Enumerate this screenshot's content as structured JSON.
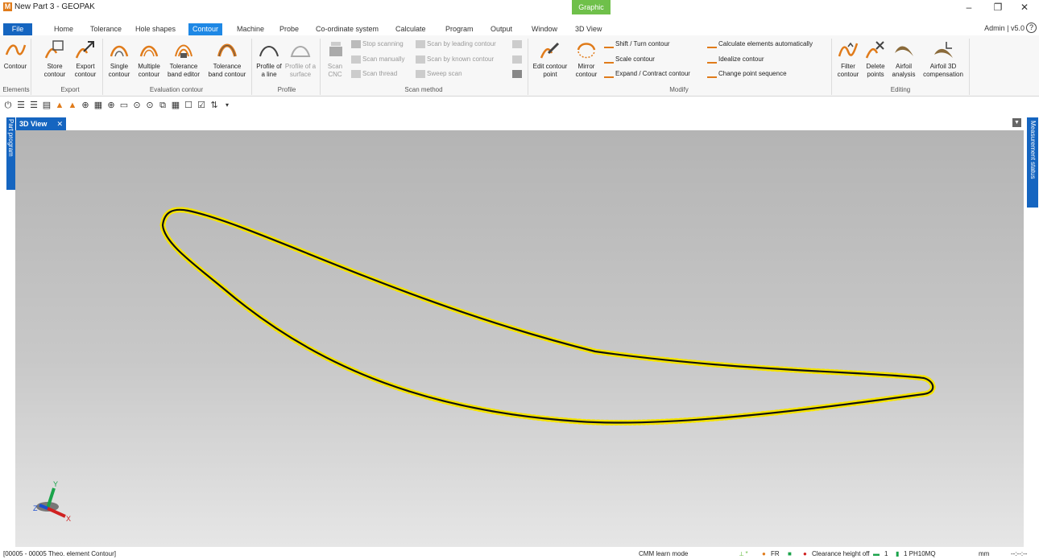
{
  "window": {
    "title": "New Part 3 - GEOPAK",
    "logo": "M",
    "context_tab": "Graphic",
    "controls": [
      "–",
      "❐",
      "✕"
    ]
  },
  "menu": {
    "file": "File",
    "tabs": [
      "Home",
      "Tolerance",
      "Hole shapes",
      "Contour",
      "Machine",
      "Probe",
      "Co-ordinate system",
      "Calculate",
      "Program",
      "Output",
      "Window",
      "3D View"
    ],
    "active": "Contour",
    "user": "Admin | v5.0",
    "help": "?"
  },
  "ribbon": {
    "elements": {
      "contour": "Contour",
      "group": "Elements"
    },
    "export": {
      "store": "Store contour",
      "export": "Export contour",
      "group": "Export"
    },
    "evaluation": {
      "single": "Single contour",
      "multiple": "Multiple contour",
      "tol_editor": "Tolerance band editor",
      "tol_contour": "Tolerance band contour",
      "group": "Evaluation contour"
    },
    "profile": {
      "line": "Profile of a line",
      "surface": "Profile of a surface",
      "group": "Profile"
    },
    "scan": {
      "cnc": "Scan CNC",
      "stop": "Stop scanning",
      "manually": "Scan manually",
      "thread": "Scan thread",
      "leading": "Scan by leading contour",
      "known": "Scan by known contour",
      "sweep": "Sweep scan",
      "group": "Scan method"
    },
    "modify": {
      "edit": "Edit contour point",
      "mirror": "Mirror contour",
      "shift": "Shift / Turn contour",
      "scale": "Scale contour",
      "expand": "Expand / Contract contour",
      "calc": "Calculate elements automatically",
      "idealize": "Idealize contour",
      "change": "Change point sequence",
      "group": "Modify"
    },
    "editing": {
      "filter": "Filter contour",
      "delete": "Delete points",
      "airfoil": "Airfoil analysis",
      "airfoil3d": "Airfoil 3D compensation",
      "group": "Editing"
    }
  },
  "side": {
    "left": "Part program",
    "right": "Measurement status"
  },
  "view": {
    "tab_label": "3D View",
    "close": "✕"
  },
  "axes": {
    "x": "X",
    "y": "Y",
    "z": "Z"
  },
  "status": {
    "left": "[00005 - 00005 Theo. element Contour]",
    "mode": "CMM learn mode",
    "fr": "FR",
    "clearance": "Clearance height off",
    "probe_no": "1",
    "probe": "1 PH10MQ",
    "unit": "mm",
    "time": "--:--:--"
  },
  "colors": {
    "accent": "#1565c0",
    "active_tab": "#1e88e5",
    "icon_orange": "#e07b1a",
    "graphic": "#6fc04a",
    "contour_points": "#f5e400"
  }
}
